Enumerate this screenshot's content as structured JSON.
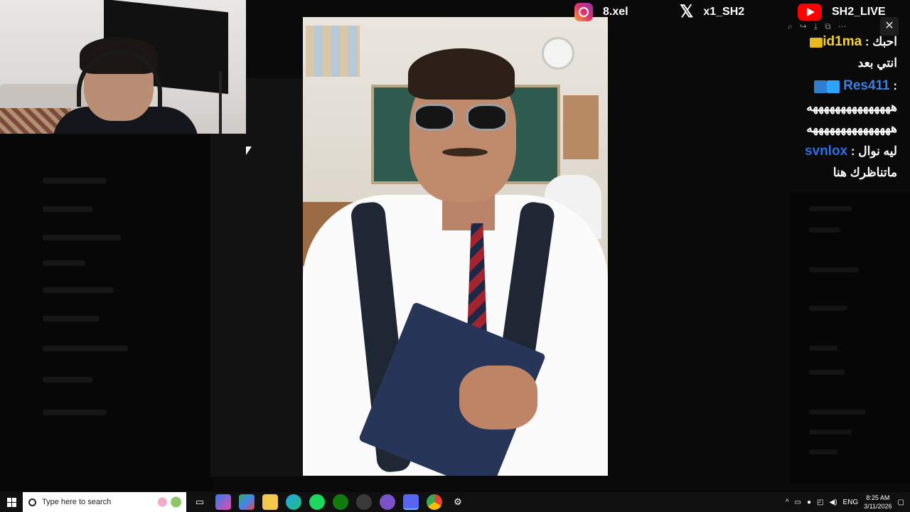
{
  "social": {
    "instagram": "8.xel",
    "x": "x1_SH2",
    "youtube": "SH2_LIVE"
  },
  "chat": {
    "messages": [
      {
        "user": "id1ma",
        "text": "احبك",
        "line2": "انتي بعد",
        "user_color": "#f5d33b"
      },
      {
        "user": "Res411",
        "text": "",
        "line2": "هههههههههههههههه",
        "line3": "هههههههههههههههه",
        "user_color": "#3b7fe6"
      },
      {
        "user": "svnlox",
        "text": "ليه نوال",
        "line2": "ماتناظرك هنا",
        "user_color": "#2e6fe0"
      }
    ],
    "close_label": "✕"
  },
  "taskbar": {
    "search_placeholder": "Type here to search",
    "language": "ENG",
    "time": "8:25 AM",
    "date": "3/11/2026"
  },
  "icons": {
    "start": "windows-start-icon",
    "search": "search-icon",
    "taskview": "task-view-icon",
    "apps": [
      "copilot-icon",
      "play-store-icon",
      "file-explorer-icon",
      "edge-icon",
      "spotify-icon",
      "xbox-icon",
      "obs-icon",
      "stream-app-icon",
      "discord-icon",
      "chrome-icon",
      "settings-icon"
    ]
  }
}
